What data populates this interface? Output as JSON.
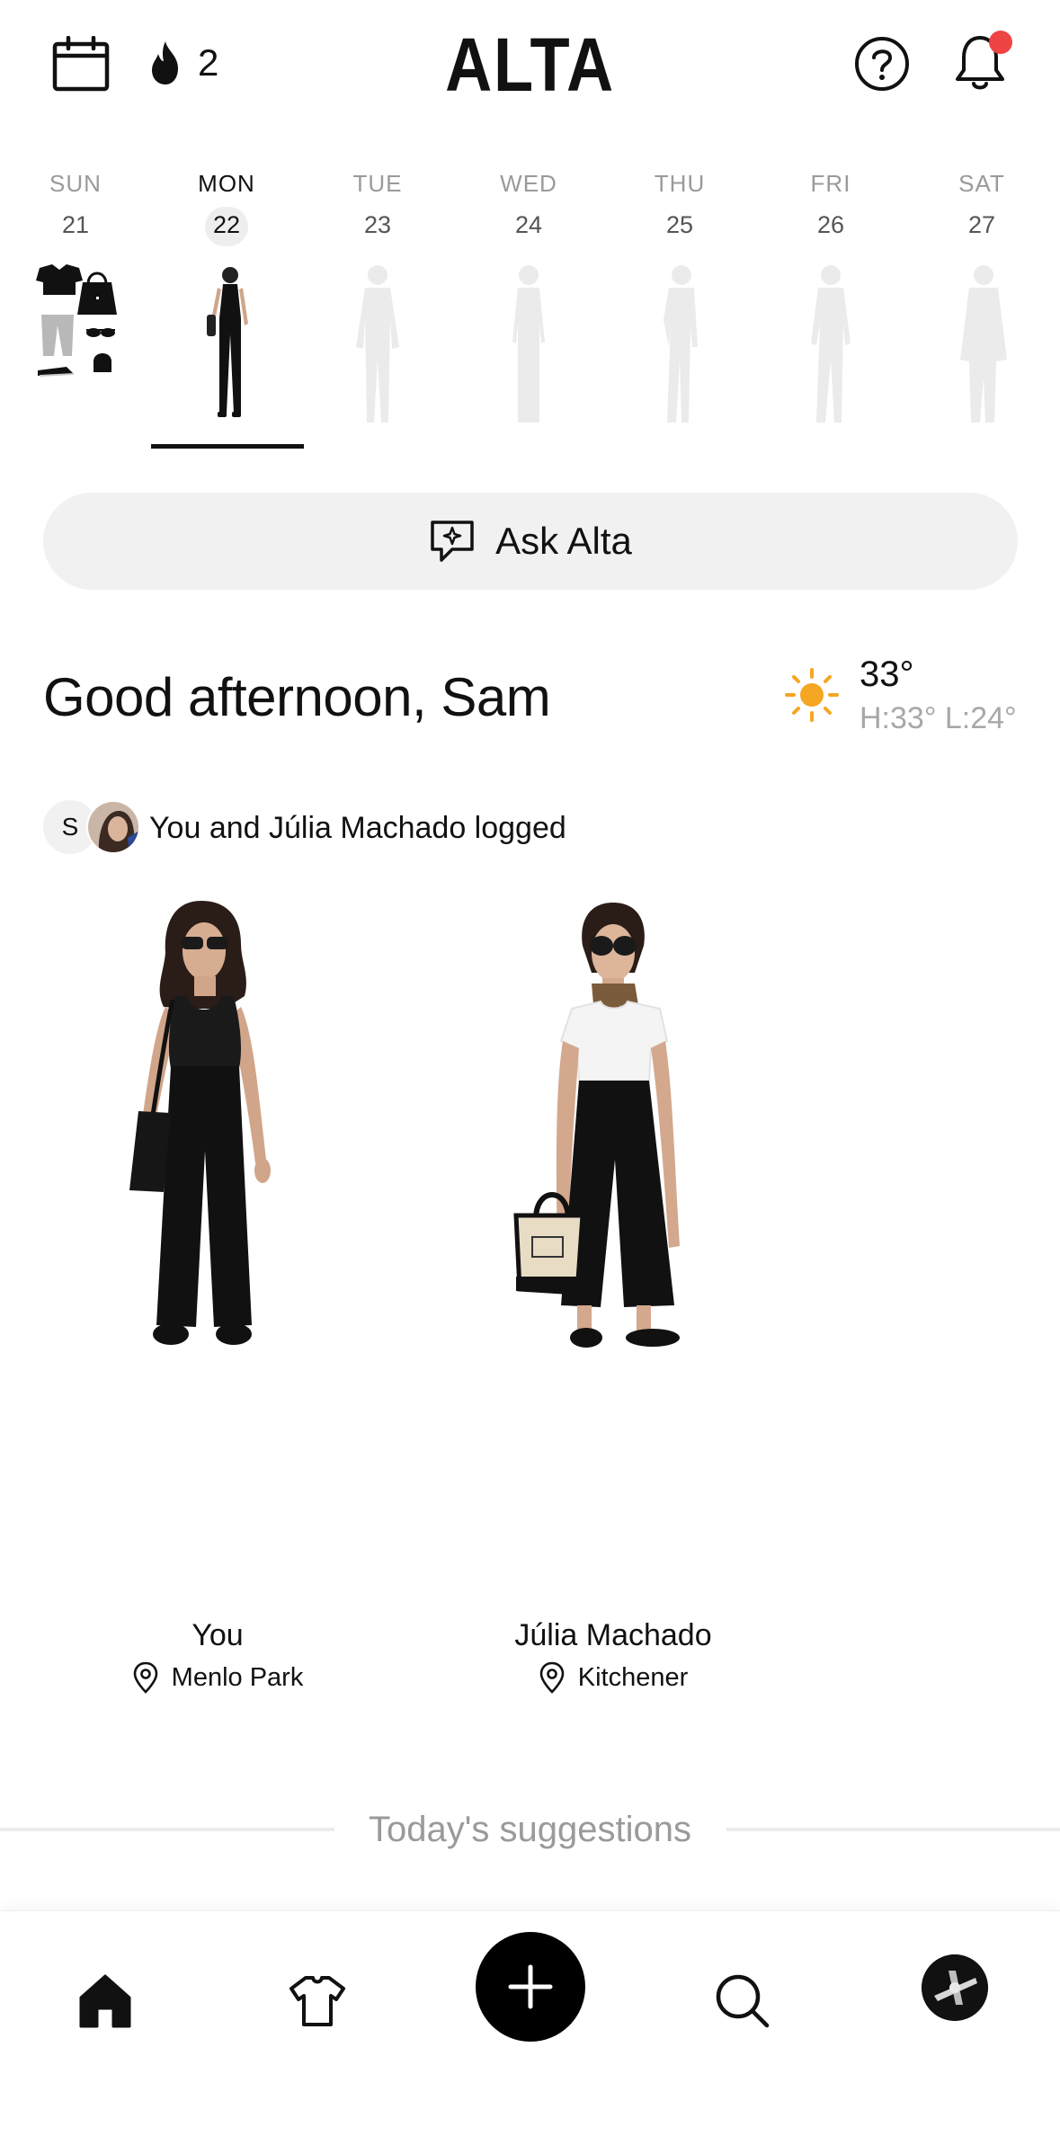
{
  "header": {
    "logo": "ALTA",
    "streak_count": "2",
    "notification_dot_color": "#ef4444",
    "icons": [
      "calendar-icon",
      "flame-icon",
      "help-icon",
      "bell-icon"
    ]
  },
  "week": {
    "days": [
      {
        "name": "SUN",
        "num": "21",
        "active": false
      },
      {
        "name": "MON",
        "num": "22",
        "active": true
      },
      {
        "name": "TUE",
        "num": "23",
        "active": false
      },
      {
        "name": "WED",
        "num": "24",
        "active": false
      },
      {
        "name": "THU",
        "num": "25",
        "active": false
      },
      {
        "name": "FRI",
        "num": "26",
        "active": false
      },
      {
        "name": "SAT",
        "num": "27",
        "active": false
      }
    ]
  },
  "ask": {
    "label": "Ask Alta"
  },
  "greeting": "Good afternoon, Sam",
  "weather": {
    "temp": "33°",
    "hilo": "H:33° L:24°",
    "icon": "sun-icon",
    "icon_color": "#f5a623"
  },
  "logged": {
    "avatar_initial": "S",
    "text": "You and Júlia Machado logged"
  },
  "outfits": [
    {
      "name": "You",
      "location": "Menlo Park"
    },
    {
      "name": "Júlia Machado",
      "location": "Kitchener"
    }
  ],
  "suggestions_label": "Today's suggestions",
  "bottom_nav": {
    "items": [
      "home-icon",
      "wardrobe-icon",
      "add-icon",
      "search-icon",
      "profile-avatar"
    ]
  }
}
